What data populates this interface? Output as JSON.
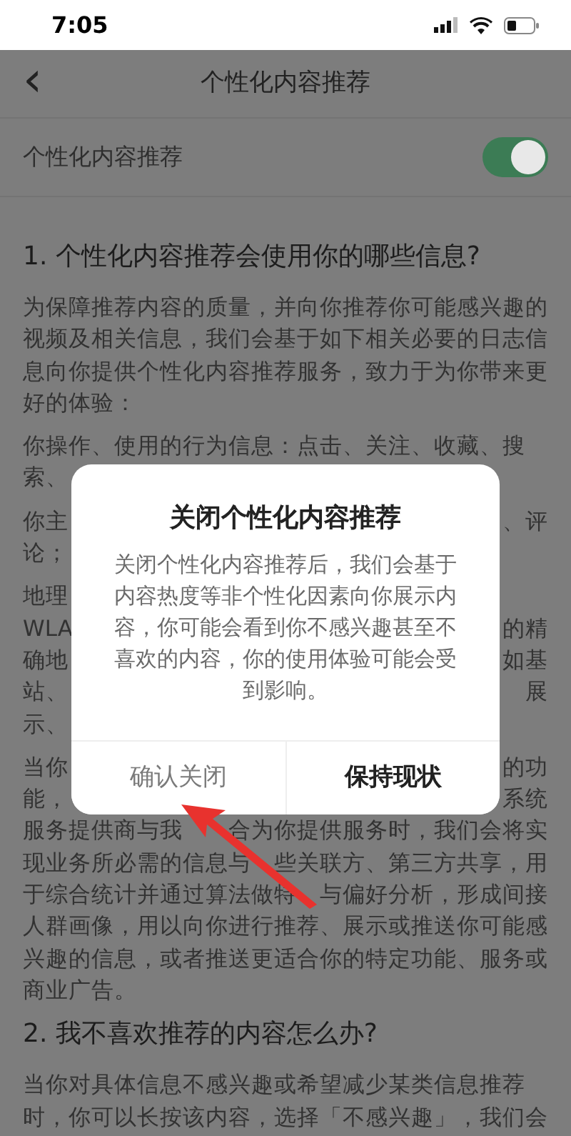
{
  "status_bar": {
    "time": "7:05"
  },
  "nav": {
    "back": "‹",
    "title": "个性化内容推荐"
  },
  "setting": {
    "label": "个性化内容推荐",
    "on": true
  },
  "sections": [
    {
      "heading": "1. 个性化内容推荐会使用你的哪些信息?",
      "paragraphs": [
        {
          "lines": [
            {
              "text": "为保障推荐内容的质量，并向你推荐你可能感兴趣的"
            },
            {
              "text": "视频及相关信息，我们会基于如下相关必要的日志信"
            },
            {
              "text": "息向你提供个性化内容推荐服务，致力于为你带来更"
            },
            {
              "text": "好的体验："
            }
          ]
        },
        {
          "lines": [
            {
              "text": "你操作、使用的行为信息：点击、关注、收藏、搜"
            },
            {
              "left": "索、"
            }
          ]
        },
        {
          "lines": [
            {
              "left": "你主",
              "right": "、评"
            },
            {
              "text": "论；"
            }
          ]
        },
        {
          "lines": [
            {
              "left": "地理"
            },
            {
              "left": "WLA",
              "right": "的精"
            },
            {
              "left": "确地",
              "right": "如基"
            },
            {
              "left": "站、",
              "right": "展"
            },
            {
              "left": "示、"
            }
          ]
        },
        {
          "lines": [
            {
              "left": "当你",
              "right": "的功"
            },
            {
              "left": "能，",
              "right": "系统"
            },
            {
              "left": "服务提供商与我",
              "right": "合为你提供服务时，我们会将实"
            },
            {
              "left": "现业务所必需的信息与",
              "right": "些关联方、第三方共享，用"
            },
            {
              "left": "于综合统计并通过算法做特",
              "right": "与偏好分析，形成间接"
            },
            {
              "text": "人群画像，用以向你进行推荐、展示或推送你可能感"
            },
            {
              "text": "兴趣的信息，或者推送更适合你的特定功能、服务或"
            },
            {
              "text": "商业广告。"
            }
          ]
        }
      ]
    },
    {
      "heading": "2. 我不喜欢推荐的内容怎么办?",
      "paragraphs": [
        {
          "lines": [
            {
              "text": "当你对具体信息不感兴趣或希望减少某类信息推荐"
            },
            {
              "text": "时，你可以长按该内容，选择「不感兴趣」，我们会"
            }
          ]
        }
      ]
    }
  ],
  "dialog": {
    "title": "关闭个性化内容推荐",
    "message": "关闭个性化内容推荐后，我们会基于内容热度等非个性化因素向你展示内容，你可能会看到你不感兴趣甚至不喜欢的内容，你的使用体验可能会受到影响。",
    "buttons": [
      {
        "label": "确认关闭",
        "kind": "secondary"
      },
      {
        "label": "保持现状",
        "kind": "primary"
      }
    ]
  }
}
